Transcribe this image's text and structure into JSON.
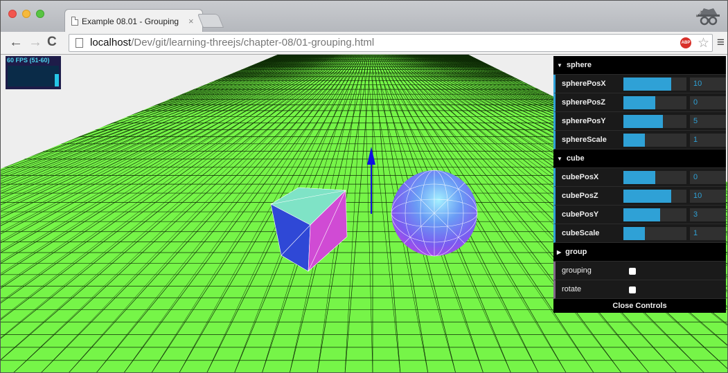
{
  "browser": {
    "tab_title": "Example 08.01 - Grouping",
    "tab_close": "×",
    "url_host": "localhost",
    "url_path": "/Dev/git/learning-threejs/chapter-08/01-grouping.html",
    "adblock_label": "ABP",
    "nav": {
      "back": "←",
      "forward": "→",
      "reload": "C"
    },
    "star": "☆",
    "menu": "≡",
    "expand": "⤢"
  },
  "stats": {
    "label": "60 FPS (51-60)",
    "fps_level": 0.6
  },
  "gui": {
    "folders": [
      {
        "title": "sphere",
        "caret": "▼",
        "controls": [
          {
            "name": "spherePosX",
            "value": "10",
            "fill": 0.76
          },
          {
            "name": "spherePosZ",
            "value": "0",
            "fill": 0.5
          },
          {
            "name": "spherePosY",
            "value": "5",
            "fill": 0.63
          },
          {
            "name": "sphereScale",
            "value": "1",
            "fill": 0.34
          }
        ]
      },
      {
        "title": "cube",
        "caret": "▼",
        "controls": [
          {
            "name": "cubePosX",
            "value": "0",
            "fill": 0.5
          },
          {
            "name": "cubePosZ",
            "value": "10",
            "fill": 0.76
          },
          {
            "name": "cubePosY",
            "value": "3",
            "fill": 0.58
          },
          {
            "name": "cubeScale",
            "value": "1",
            "fill": 0.34
          }
        ]
      },
      {
        "title": "group",
        "caret": "▶",
        "controls": []
      }
    ],
    "booleans": [
      {
        "name": "grouping",
        "checked": false
      },
      {
        "name": "rotate",
        "checked": false
      }
    ],
    "close_label": "Close Controls"
  },
  "colors": {
    "ground": "#76f548",
    "sky": "#eeeeee",
    "gui_accent": "#2fa1d6",
    "bool_accent": "#806787",
    "arrow": "#1010e0"
  }
}
